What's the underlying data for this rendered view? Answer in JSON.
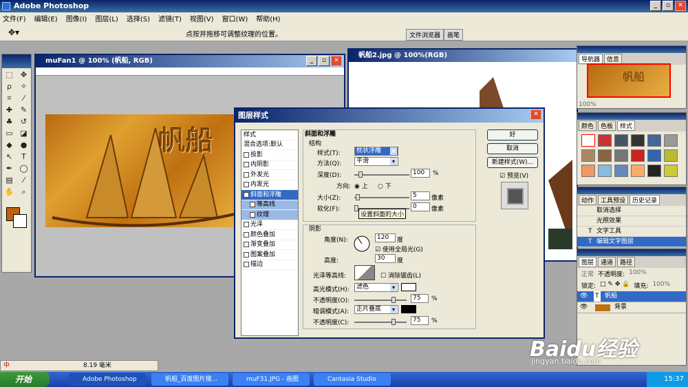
{
  "app": {
    "title": "Adobe Photoshop"
  },
  "menu": [
    "文件(F)",
    "编辑(E)",
    "图像(I)",
    "图层(L)",
    "选择(S)",
    "滤镜(T)",
    "视图(V)",
    "窗口(W)",
    "帮助(H)"
  ],
  "options": {
    "hint": "点按并拖移可调整纹理的位置。",
    "tab1": "文件浏览器",
    "tab2": "画笔"
  },
  "doc1": {
    "title": "muFan1 @ 100% (帆船, RGB)",
    "art_text": "帆船"
  },
  "doc2": {
    "title": "帆船2.jpg @ 100%(RGB)"
  },
  "dialog": {
    "title": "图层样式",
    "styles": [
      {
        "label": "样式",
        "check": false
      },
      {
        "label": "混合选项:默认",
        "check": false
      },
      {
        "label": "投影",
        "check": true
      },
      {
        "label": "内阴影",
        "check": true
      },
      {
        "label": "外发光",
        "check": true
      },
      {
        "label": "内发光",
        "check": true
      },
      {
        "label": "斜面和浮雕",
        "check": true
      },
      {
        "label": "等高线",
        "check": true
      },
      {
        "label": "纹理",
        "check": true
      },
      {
        "label": "光泽",
        "check": true
      },
      {
        "label": "颜色叠加",
        "check": true
      },
      {
        "label": "渐变叠加",
        "check": true
      },
      {
        "label": "图案叠加",
        "check": true
      },
      {
        "label": "描边",
        "check": true
      }
    ],
    "bevel_title": "斜面和浮雕",
    "structure": "结构",
    "style_lbl": "样式(T):",
    "style_val": "枕状浮雕",
    "method_lbl": "方法(Q):",
    "method_val": "平滑",
    "depth_lbl": "深度(D):",
    "depth_val": "100",
    "pct": "%",
    "direction_lbl": "方向:",
    "dir_up": "上",
    "dir_down": "下",
    "size_lbl": "大小(Z):",
    "size_val": "5",
    "px": "像素",
    "soften_lbl": "软化(F):",
    "soften_val": "0",
    "tooltip": "设置斜面的大小",
    "shading": "阴影",
    "angle_lbl": "角度(N):",
    "angle_val": "120",
    "deg": "度",
    "global_light": "使用全局光(G)",
    "altitude_lbl": "高度:",
    "altitude_val": "30",
    "gloss_lbl": "光泽等高线:",
    "antialias": "消除锯齿(L)",
    "hl_mode_lbl": "高光模式(H):",
    "hl_mode_val": "滤色",
    "opacity_lbl": "不透明度(O):",
    "opacity_val": "75",
    "sh_mode_lbl": "暗调模式(A):",
    "sh_mode_val": "正片叠底",
    "opacity2_lbl": "不透明度(C):",
    "opacity2_val": "75",
    "ok": "好",
    "cancel": "取消",
    "new_style": "新建样式(W)...",
    "preview": "预览(V)"
  },
  "nav": {
    "tab1": "导航器",
    "tab2": "信息",
    "zoom": "100%",
    "thumb_text": "帆船"
  },
  "color": {
    "tab1": "颜色",
    "tab2": "色板",
    "tab3": "样式"
  },
  "history": {
    "tab1": "动作",
    "tab2": "工具预设",
    "tab3": "历史记录",
    "items": [
      "取消选择",
      "光照效果",
      "文字工具",
      "编辑文字图层"
    ]
  },
  "layers": {
    "tab1": "图层",
    "tab2": "通道",
    "tab3": "路径",
    "mode": "正常",
    "opacity_lbl": "不透明度:",
    "opacity": "100%",
    "lock": "锁定:",
    "fill_lbl": "填充:",
    "fill": "100%",
    "items": [
      "帆船",
      "背景"
    ]
  },
  "status": {
    "ime": "中",
    "dim": "8.19 毫米"
  },
  "taskbar": {
    "start": "开始",
    "tasks": [
      "Adobe Photoshop",
      "帆船_百度图片搜...",
      "muF31.JPG - 画图",
      "Cantasia Studio"
    ],
    "time": "15:37"
  },
  "watermark": {
    "brand": "Baidu经验",
    "url": "jingyan.baidu.com"
  },
  "colors": {
    "title_blue": "#0a246a",
    "highlight": "#316ac5",
    "doc_orange": "#c06010"
  }
}
